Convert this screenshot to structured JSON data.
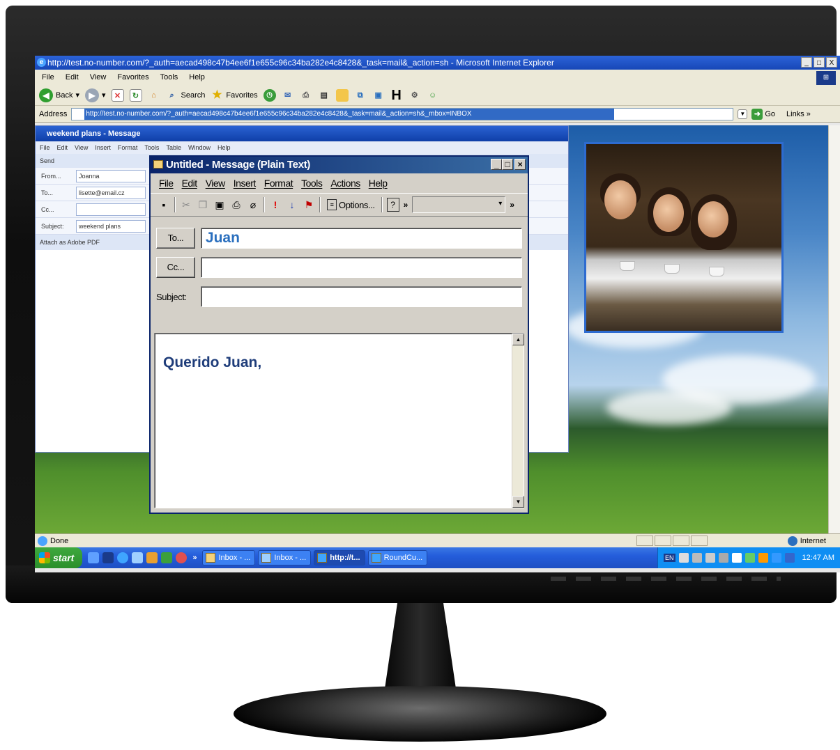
{
  "ie": {
    "title": "http://test.no-number.com/?_auth=aecad498c47b4ee6f1e655c96c34ba282e4c8428&_task=mail&_action=sh - Microsoft Internet Explorer",
    "window_controls": [
      "_",
      "□",
      "X"
    ],
    "menu": [
      "File",
      "Edit",
      "View",
      "Favorites",
      "Tools",
      "Help"
    ],
    "toolbar": {
      "back": "Back",
      "search": "Search",
      "favorites": "Favorites"
    },
    "address_label": "Address",
    "address_value": "http://test.no-number.com/?_auth=aecad498c47b4ee6f1e655c96c34ba282e4c8428&_task=mail&_action=sh&_mbox=INBOX",
    "go": "Go",
    "links": "Links"
  },
  "background_message": {
    "title": "weekend plans - Message",
    "menu": [
      "File",
      "Edit",
      "View",
      "Insert",
      "Format",
      "Tools",
      "Table",
      "Window",
      "Help"
    ],
    "send_label": "Send",
    "from_label": "From...",
    "from_value": "Joanna",
    "to_label": "To...",
    "to_value": "lisette@email.cz",
    "cc_label": "Cc...",
    "subject_label": "Subject:",
    "subject_value": "weekend plans",
    "attach_label": "Attach as Adobe PDF"
  },
  "compose": {
    "title": "Untitled - Message (Plain Text)",
    "menu": [
      "File",
      "Edit",
      "View",
      "Insert",
      "Format",
      "Tools",
      "Actions",
      "Help"
    ],
    "options_label": "Options...",
    "to_button": "To...",
    "to_value": "Juan",
    "cc_button": "Cc...",
    "cc_value": "",
    "subject_label": "Subject:",
    "subject_value": "",
    "body": "Querido Juan,"
  },
  "status": {
    "text": "Done",
    "zone": "Internet"
  },
  "taskbar": {
    "start": "start",
    "chevron": "»",
    "items": [
      {
        "label": "Inbox - ...",
        "active": false
      },
      {
        "label": "Inbox - ...",
        "active": false
      },
      {
        "label": "http://t...",
        "active": true
      },
      {
        "label": "RoundCu...",
        "active": false
      }
    ],
    "language": "EN",
    "clock": "12:47 AM"
  },
  "colors": {
    "xp_blue": "#245ddb",
    "compose_title": "#0a246a",
    "to_text": "#2a6fbe",
    "body_text": "#1f3d7a",
    "photo_frame": "#2d6bd0"
  }
}
